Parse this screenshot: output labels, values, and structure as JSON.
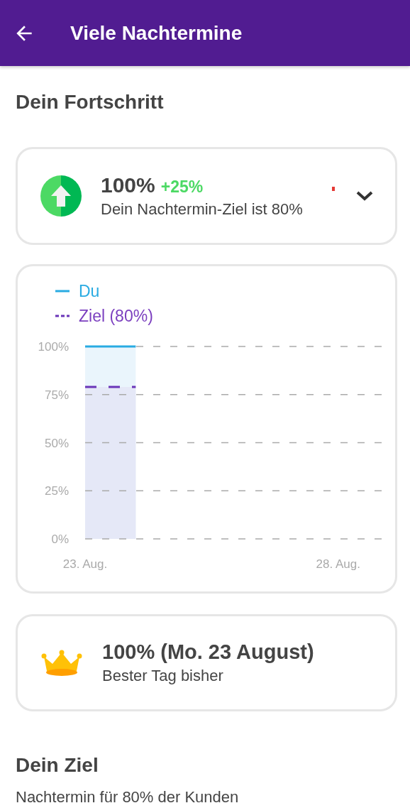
{
  "app_bar": {
    "title": "Viele Nachtermine"
  },
  "progress": {
    "heading": "Dein Fortschritt",
    "summary": {
      "value": "100%",
      "change": "+25%",
      "subtitle": "Dein Nachtermin-Ziel ist 80%",
      "expanded": false
    },
    "chart_data": {
      "type": "area",
      "grid": "y",
      "legend": "top-left",
      "categories": [
        "23. Aug.",
        null,
        null,
        null,
        null,
        "28. Aug.",
        null
      ],
      "ylim": [
        0,
        100
      ],
      "yticks": [
        {
          "value": 0,
          "label": "0%"
        },
        {
          "value": 25,
          "label": "25%"
        },
        {
          "value": 50,
          "label": "50%"
        },
        {
          "value": 75,
          "label": "75%"
        },
        {
          "value": 100,
          "label": "100%"
        }
      ],
      "series": [
        {
          "name": "Du",
          "color": "#29abe2",
          "values": [
            100,
            100,
            null,
            null,
            null,
            null,
            null
          ]
        },
        {
          "name": "Ziel (80%)",
          "color": "#6a35b8",
          "values": [
            79,
            79,
            null,
            null,
            null,
            null,
            null
          ]
        }
      ]
    },
    "best_day": {
      "value": "100% (Mo. 23 August)",
      "label": "Bester Tag bisher"
    }
  },
  "goal": {
    "heading": "Dein Ziel",
    "text": "Nachtermin für 80% der Kunden"
  }
}
